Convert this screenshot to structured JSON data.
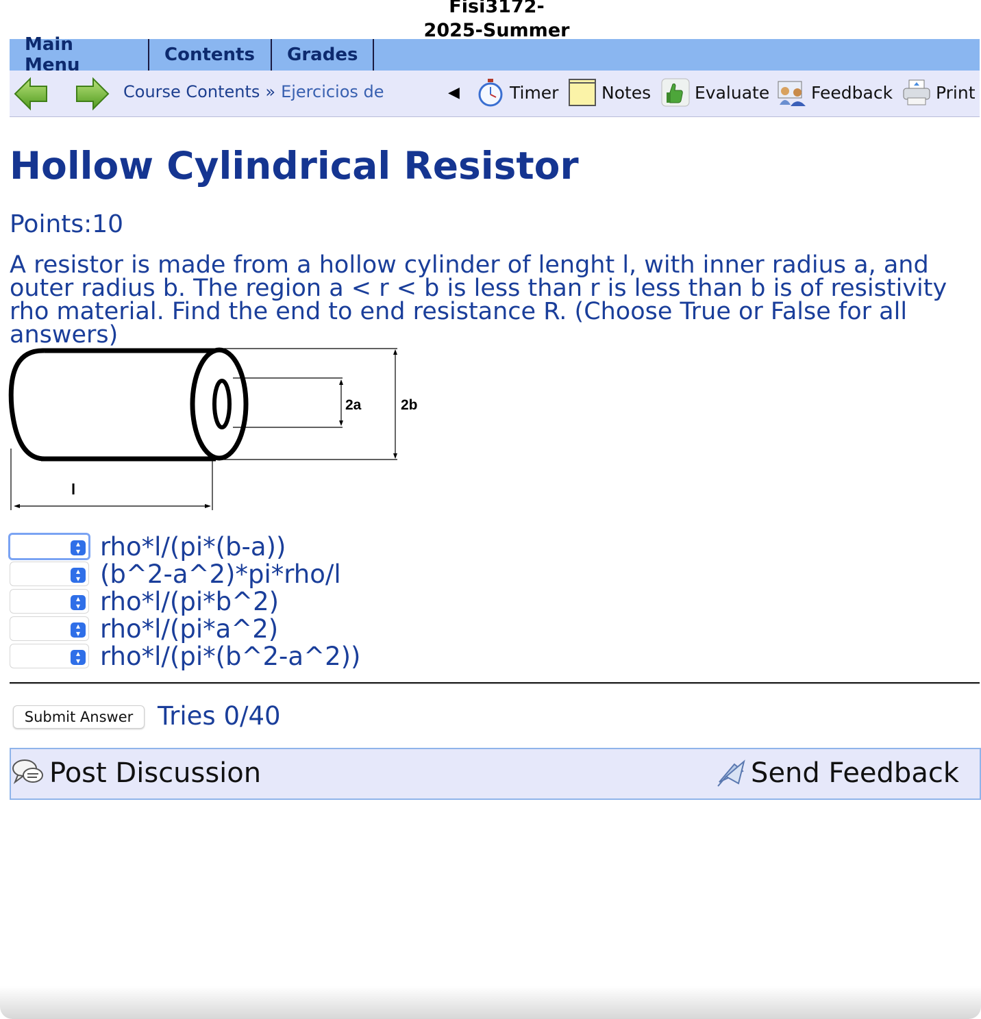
{
  "course": {
    "title_line1": "Fisi3172-",
    "title_line2": "2025-Summer"
  },
  "menubar": {
    "tabs": [
      {
        "label": "Main Menu"
      },
      {
        "label": "Contents"
      },
      {
        "label": "Grades"
      }
    ]
  },
  "toolbar": {
    "breadcrumb_root": "Course Contents",
    "breadcrumb_separator": "»",
    "breadcrumb_current": "Ejercicios de",
    "collapse_glyph": "◀",
    "timer_label": "Timer",
    "notes_label": "Notes",
    "evaluate_label": "Evaluate",
    "feedback_label": "Feedback",
    "print_label": "Print"
  },
  "problem": {
    "title": "Hollow Cylindrical Resistor",
    "points": "Points:10",
    "text": "A resistor is made from a hollow cylinder of lenght l, with inner radius a, and outer radius b. The region a < r < b is less than r is less than b is of resistivity rho material. Find the end to end resistance R. (Choose True or False for all answers)",
    "figure_labels": {
      "inner": "2a",
      "outer": "2b",
      "length": "l"
    }
  },
  "answers": [
    {
      "selected": "",
      "label": "rho*l/(pi*(b-a))"
    },
    {
      "selected": "",
      "label": "(b^2-a^2)*pi*rho/l"
    },
    {
      "selected": "",
      "label": "rho*l/(pi*b^2)"
    },
    {
      "selected": "",
      "label": "rho*l/(pi*a^2)"
    },
    {
      "selected": "",
      "label": "rho*l/(pi*(b^2-a^2))"
    }
  ],
  "submit": {
    "label": "Submit Answer",
    "tries": "Tries 0/40"
  },
  "footer": {
    "post_label": "Post Discussion",
    "send_label": "Send Feedback"
  },
  "colors": {
    "menubar": "#8ab6f0",
    "toolbar": "#e6e8fa",
    "title": "#153591",
    "text": "#1a3e9a",
    "select_knob": "#2f6fe8"
  }
}
